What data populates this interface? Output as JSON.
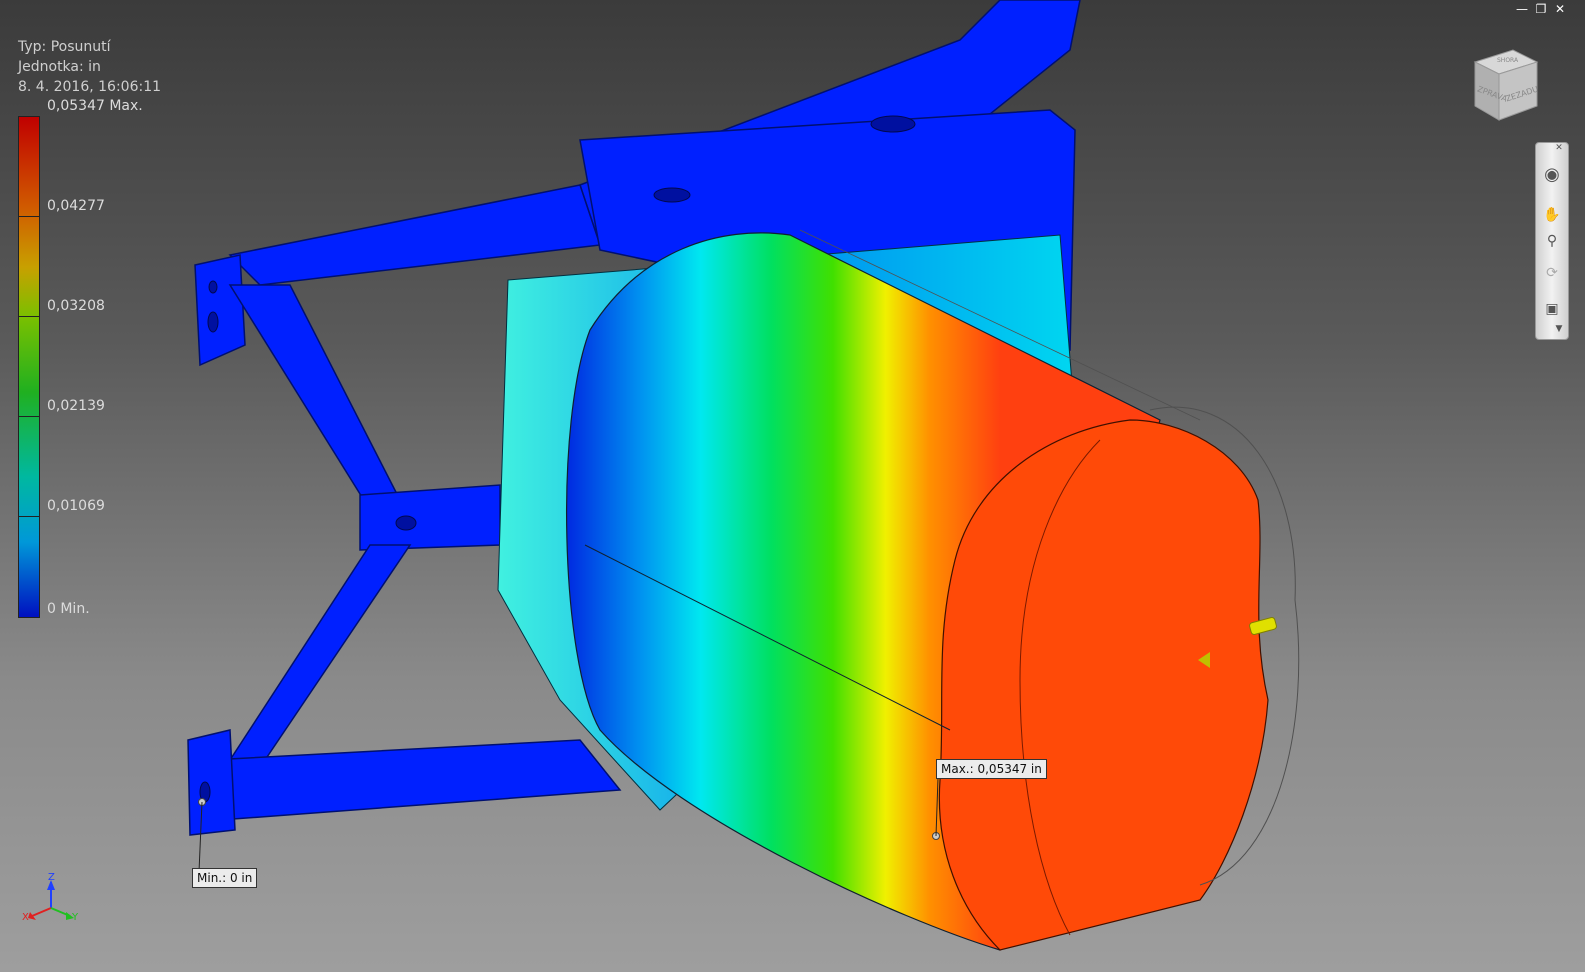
{
  "header": {
    "type_label": "Typ: Posunutí",
    "unit_label": "Jednotka: in",
    "datetime": "8. 4. 2016, 16:06:11"
  },
  "legend": {
    "max_label": "0,05347 Max.",
    "values": [
      "0,04277",
      "0,03208",
      "0,02139",
      "0,01069"
    ],
    "min_label": "0 Min."
  },
  "callouts": {
    "max": "Max.: 0,05347 in",
    "min": "Min.: 0 in"
  },
  "viewcube": {
    "faces": [
      "ZPRAVA",
      "ZEZADU",
      "SHORA"
    ]
  },
  "navigation_bar": {
    "tools": [
      "steering-wheel-icon",
      "pan-icon",
      "zoom-icon",
      "orbit-icon",
      "look-at-icon"
    ]
  },
  "window_controls": [
    "minimize-icon",
    "restore-icon",
    "close-icon"
  ],
  "triad": {
    "x": "X",
    "y": "Y",
    "z": "Z"
  },
  "colors": {
    "max": "#c00000",
    "min": "#0010c0",
    "background_top": "#3b3b3b",
    "background_bottom": "#9e9e9e"
  }
}
